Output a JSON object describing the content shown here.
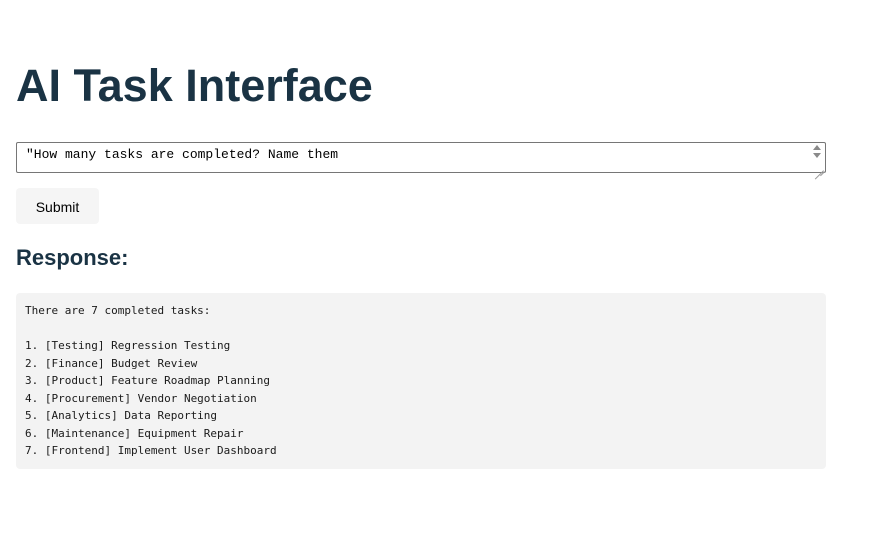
{
  "page": {
    "title": "AI Task Interface"
  },
  "query": {
    "value": "\"How many tasks are completed? Name them"
  },
  "submit": {
    "label": "Submit"
  },
  "response": {
    "heading": "Response:",
    "intro": "There are 7 completed tasks:",
    "items": [
      "1. [Testing] Regression Testing",
      "2. [Finance] Budget Review",
      "3. [Product] Feature Roadmap Planning",
      "4. [Procurement] Vendor Negotiation",
      "5. [Analytics] Data Reporting",
      "6. [Maintenance] Equipment Repair",
      "7. [Frontend] Implement User Dashboard"
    ]
  },
  "colors": {
    "heading": "#1a3344",
    "response_bg": "#f3f3f3",
    "button_bg": "#f5f5f5"
  }
}
